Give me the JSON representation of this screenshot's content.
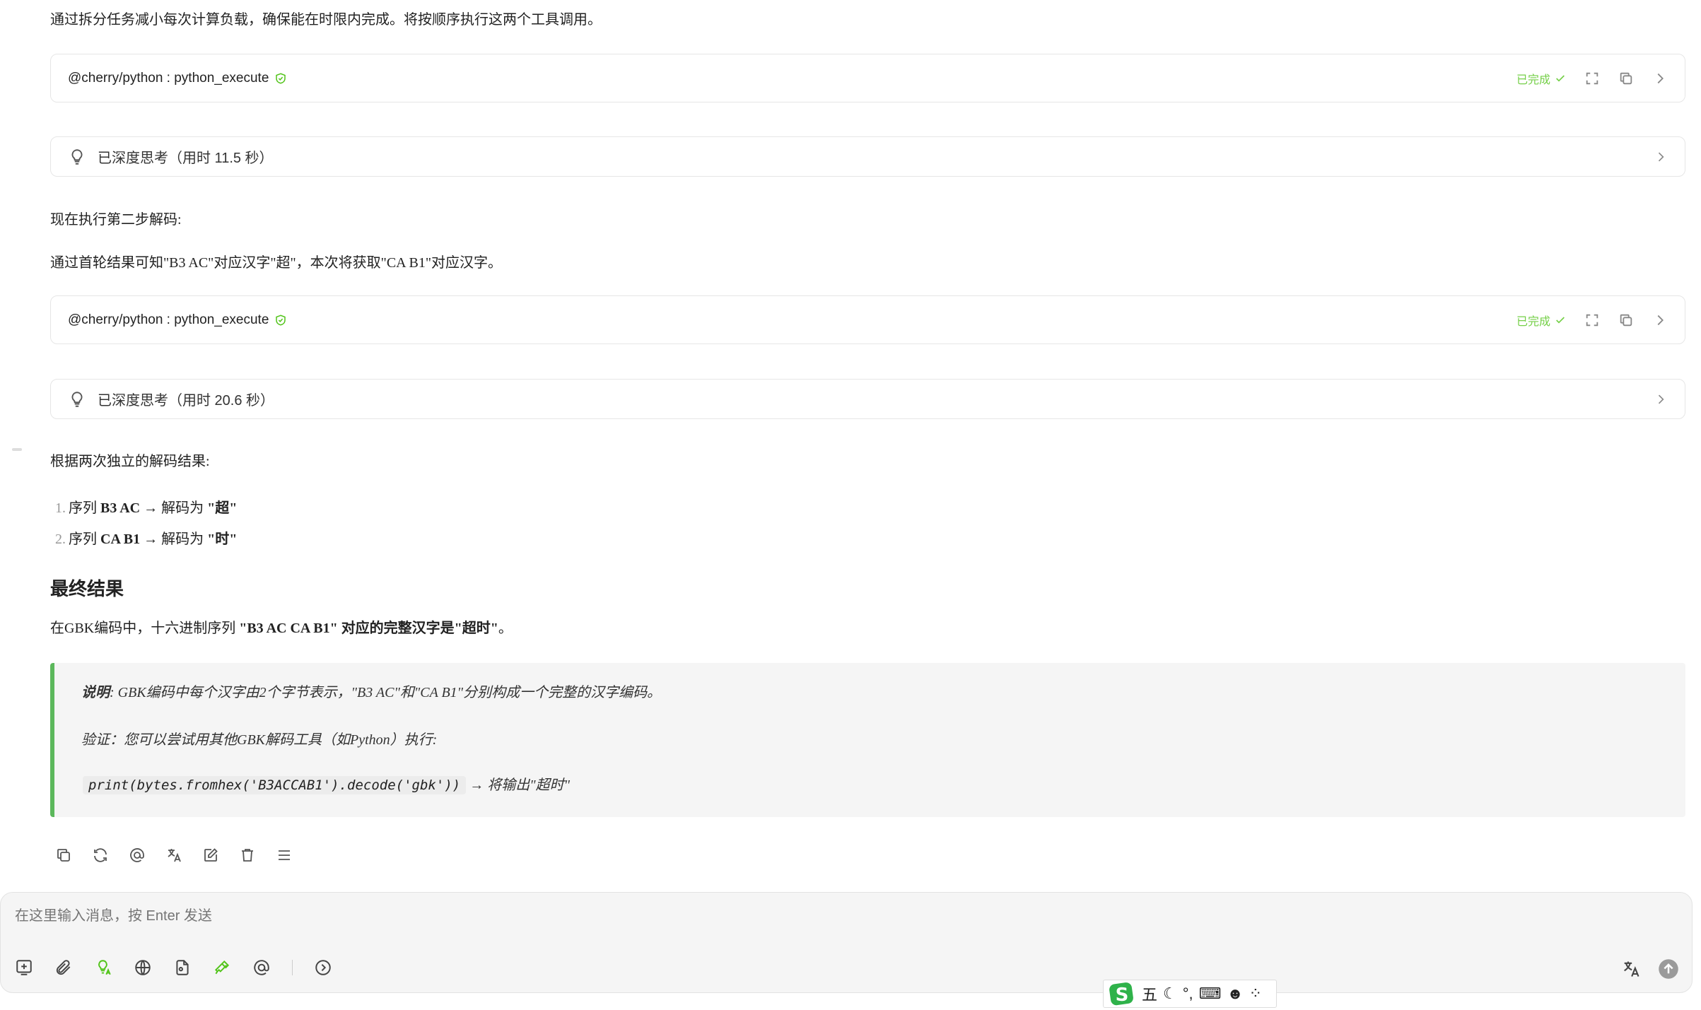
{
  "messages": {
    "intro": "通过拆分任务减小每次计算负载，确保能在时限内完成。将按顺序执行这两个工具调用。",
    "tool_calls": [
      {
        "name": "@cherry/python : python_execute",
        "status": "已完成"
      },
      {
        "name": "@cherry/python : python_execute",
        "status": "已完成"
      }
    ],
    "thinking": [
      {
        "label": "已深度思考（用时 11.5 秒）"
      },
      {
        "label": "已深度思考（用时 20.6 秒）"
      }
    ],
    "step2_title": "现在执行第二步解码:",
    "step2_detail": "通过首轮结果可知\"B3 AC\"对应汉字\"超\"，本次将获取\"CA B1\"对应汉字。",
    "results_intro": "根据两次独立的解码结果:",
    "results": [
      {
        "num": "1.",
        "prefix": "序列 ",
        "seq": "B3 AC",
        "arrow": " → 解码为 ",
        "char": "\"超\""
      },
      {
        "num": "2.",
        "prefix": "序列 ",
        "seq": "CA B1",
        "arrow": " → 解码为 ",
        "char": "\"时\""
      }
    ],
    "final_heading": "最终结果",
    "final_prefix": "在GBK编码中，十六进制序列 ",
    "final_bold": "\"B3 AC CA B1\" 对应的完整汉字是\"超时\"",
    "final_suffix": "。",
    "quote": {
      "note_label": "说明",
      "note_text": ": GBK编码中每个汉字由2个字节表示，\"B3 AC\"和\"CA B1\"分别构成一个完整的汉字编码。",
      "verify_text": "验证：您可以尝试用其他GBK解码工具（如Python）执行:",
      "code": "print(bytes.fromhex('B3ACCAB1').decode('gbk'))",
      "code_suffix": " → 将输出\"超时\""
    }
  },
  "message_actions": [
    "copy-icon",
    "refresh-icon",
    "mention-icon",
    "translate-icon",
    "edit-icon",
    "delete-icon",
    "menu-icon"
  ],
  "input": {
    "placeholder": "在这里输入消息，按 Enter 发送",
    "tools": [
      "new-topic-icon",
      "attach-icon",
      "knowledge-icon",
      "web-search-icon",
      "file-icon",
      "mcp-tools-icon",
      "mention-icon",
      "expand-icon"
    ]
  },
  "ime": {
    "mode": "五"
  },
  "colors": {
    "accent": "#52c41a",
    "quote_border": "#5cb85c",
    "input_bg": "#f5f5f5"
  }
}
